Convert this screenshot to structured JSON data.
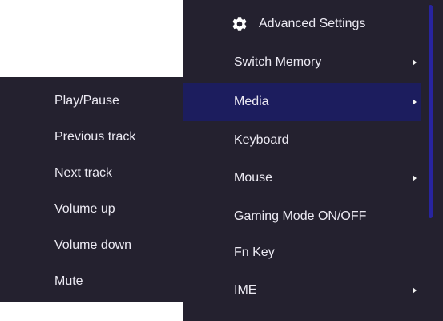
{
  "main_menu": {
    "header": {
      "icon": "gear-icon",
      "label": "Advanced Settings"
    },
    "items": [
      {
        "label": "Switch Memory",
        "has_submenu": true,
        "selected": false
      },
      {
        "label": "Media",
        "has_submenu": true,
        "selected": true
      },
      {
        "label": "Keyboard",
        "has_submenu": false,
        "selected": false
      },
      {
        "label": "Mouse",
        "has_submenu": true,
        "selected": false
      },
      {
        "label": "Gaming Mode ON/OFF",
        "has_submenu": false,
        "selected": false
      },
      {
        "label": "Fn Key",
        "has_submenu": false,
        "selected": false
      },
      {
        "label": "IME",
        "has_submenu": true,
        "selected": false
      }
    ]
  },
  "media_submenu": {
    "items": [
      {
        "label": "Play/Pause"
      },
      {
        "label": "Previous track"
      },
      {
        "label": "Next track"
      },
      {
        "label": "Volume up"
      },
      {
        "label": "Volume down"
      },
      {
        "label": "Mute"
      }
    ]
  },
  "colors": {
    "menu_background": "#24212f",
    "selected_background": "#1c1d5e",
    "scrollbar": "#28249f",
    "text": "#eceaf3"
  }
}
